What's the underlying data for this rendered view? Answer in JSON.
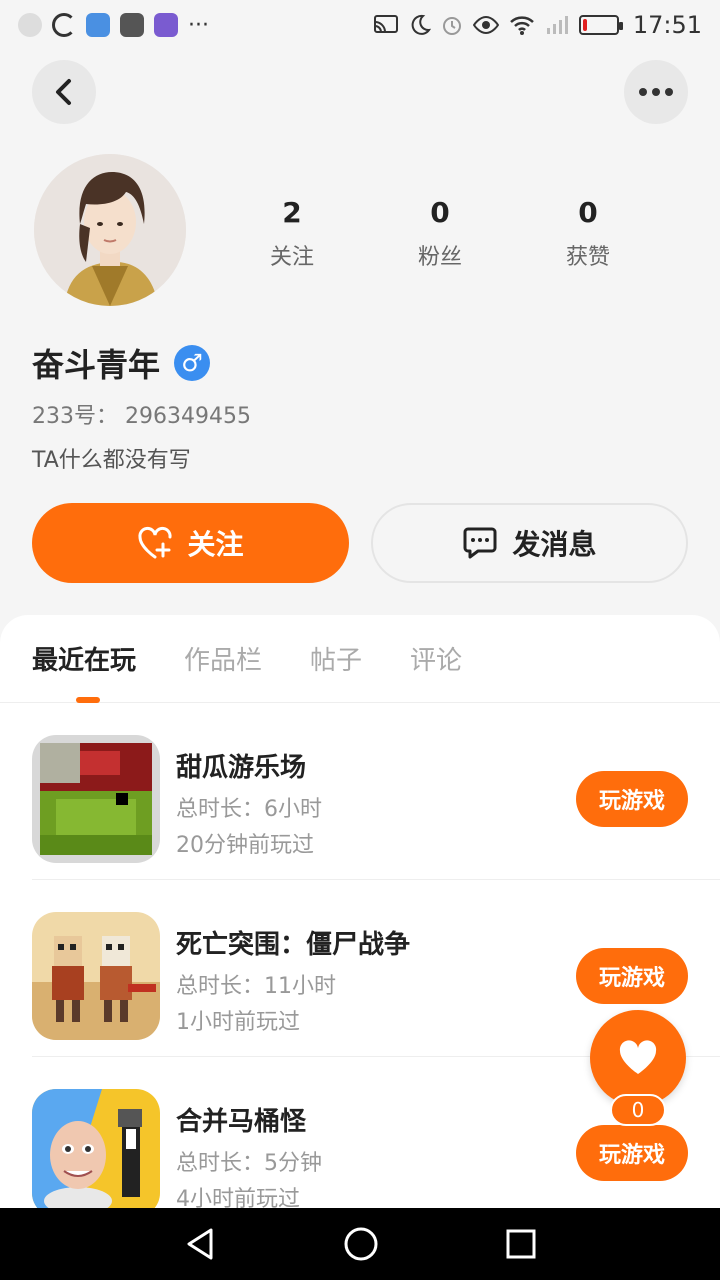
{
  "status_bar": {
    "time": "17:51",
    "battery_level": 0.12,
    "colors": {
      "battery_low": "#e02020"
    }
  },
  "profile": {
    "username": "奋斗青年",
    "gender_symbol": "♂",
    "uid_text": "233号： 296349455",
    "bio": "TA什么都没有写",
    "stats": [
      {
        "value": "2",
        "label": "关注"
      },
      {
        "value": "0",
        "label": "粉丝"
      },
      {
        "value": "0",
        "label": "获赞"
      }
    ]
  },
  "actions": {
    "follow_label": "关注",
    "message_label": "发消息"
  },
  "tabs": [
    {
      "label": "最近在玩",
      "active": true
    },
    {
      "label": "作品栏",
      "active": false
    },
    {
      "label": "帖子",
      "active": false
    },
    {
      "label": "评论",
      "active": false
    }
  ],
  "games": [
    {
      "name": "甜瓜游乐场",
      "duration": "总时长：6小时",
      "last_played": "20分钟前玩过",
      "button": "玩游戏",
      "icon": "melon-playground-icon"
    },
    {
      "name": "死亡突围：僵尸战争",
      "duration": "总时长：11小时",
      "last_played": "1小时前玩过",
      "button": "玩游戏",
      "icon": "dead-ahead-icon"
    },
    {
      "name": "合并马桶怪",
      "duration": "总时长：5分钟",
      "last_played": "4小时前玩过",
      "button": "玩游戏",
      "icon": "toilet-monster-icon"
    }
  ],
  "like_fab": {
    "count": "0"
  },
  "colors": {
    "accent": "#ff6d0c",
    "gender_blue": "#3a8ef0"
  }
}
